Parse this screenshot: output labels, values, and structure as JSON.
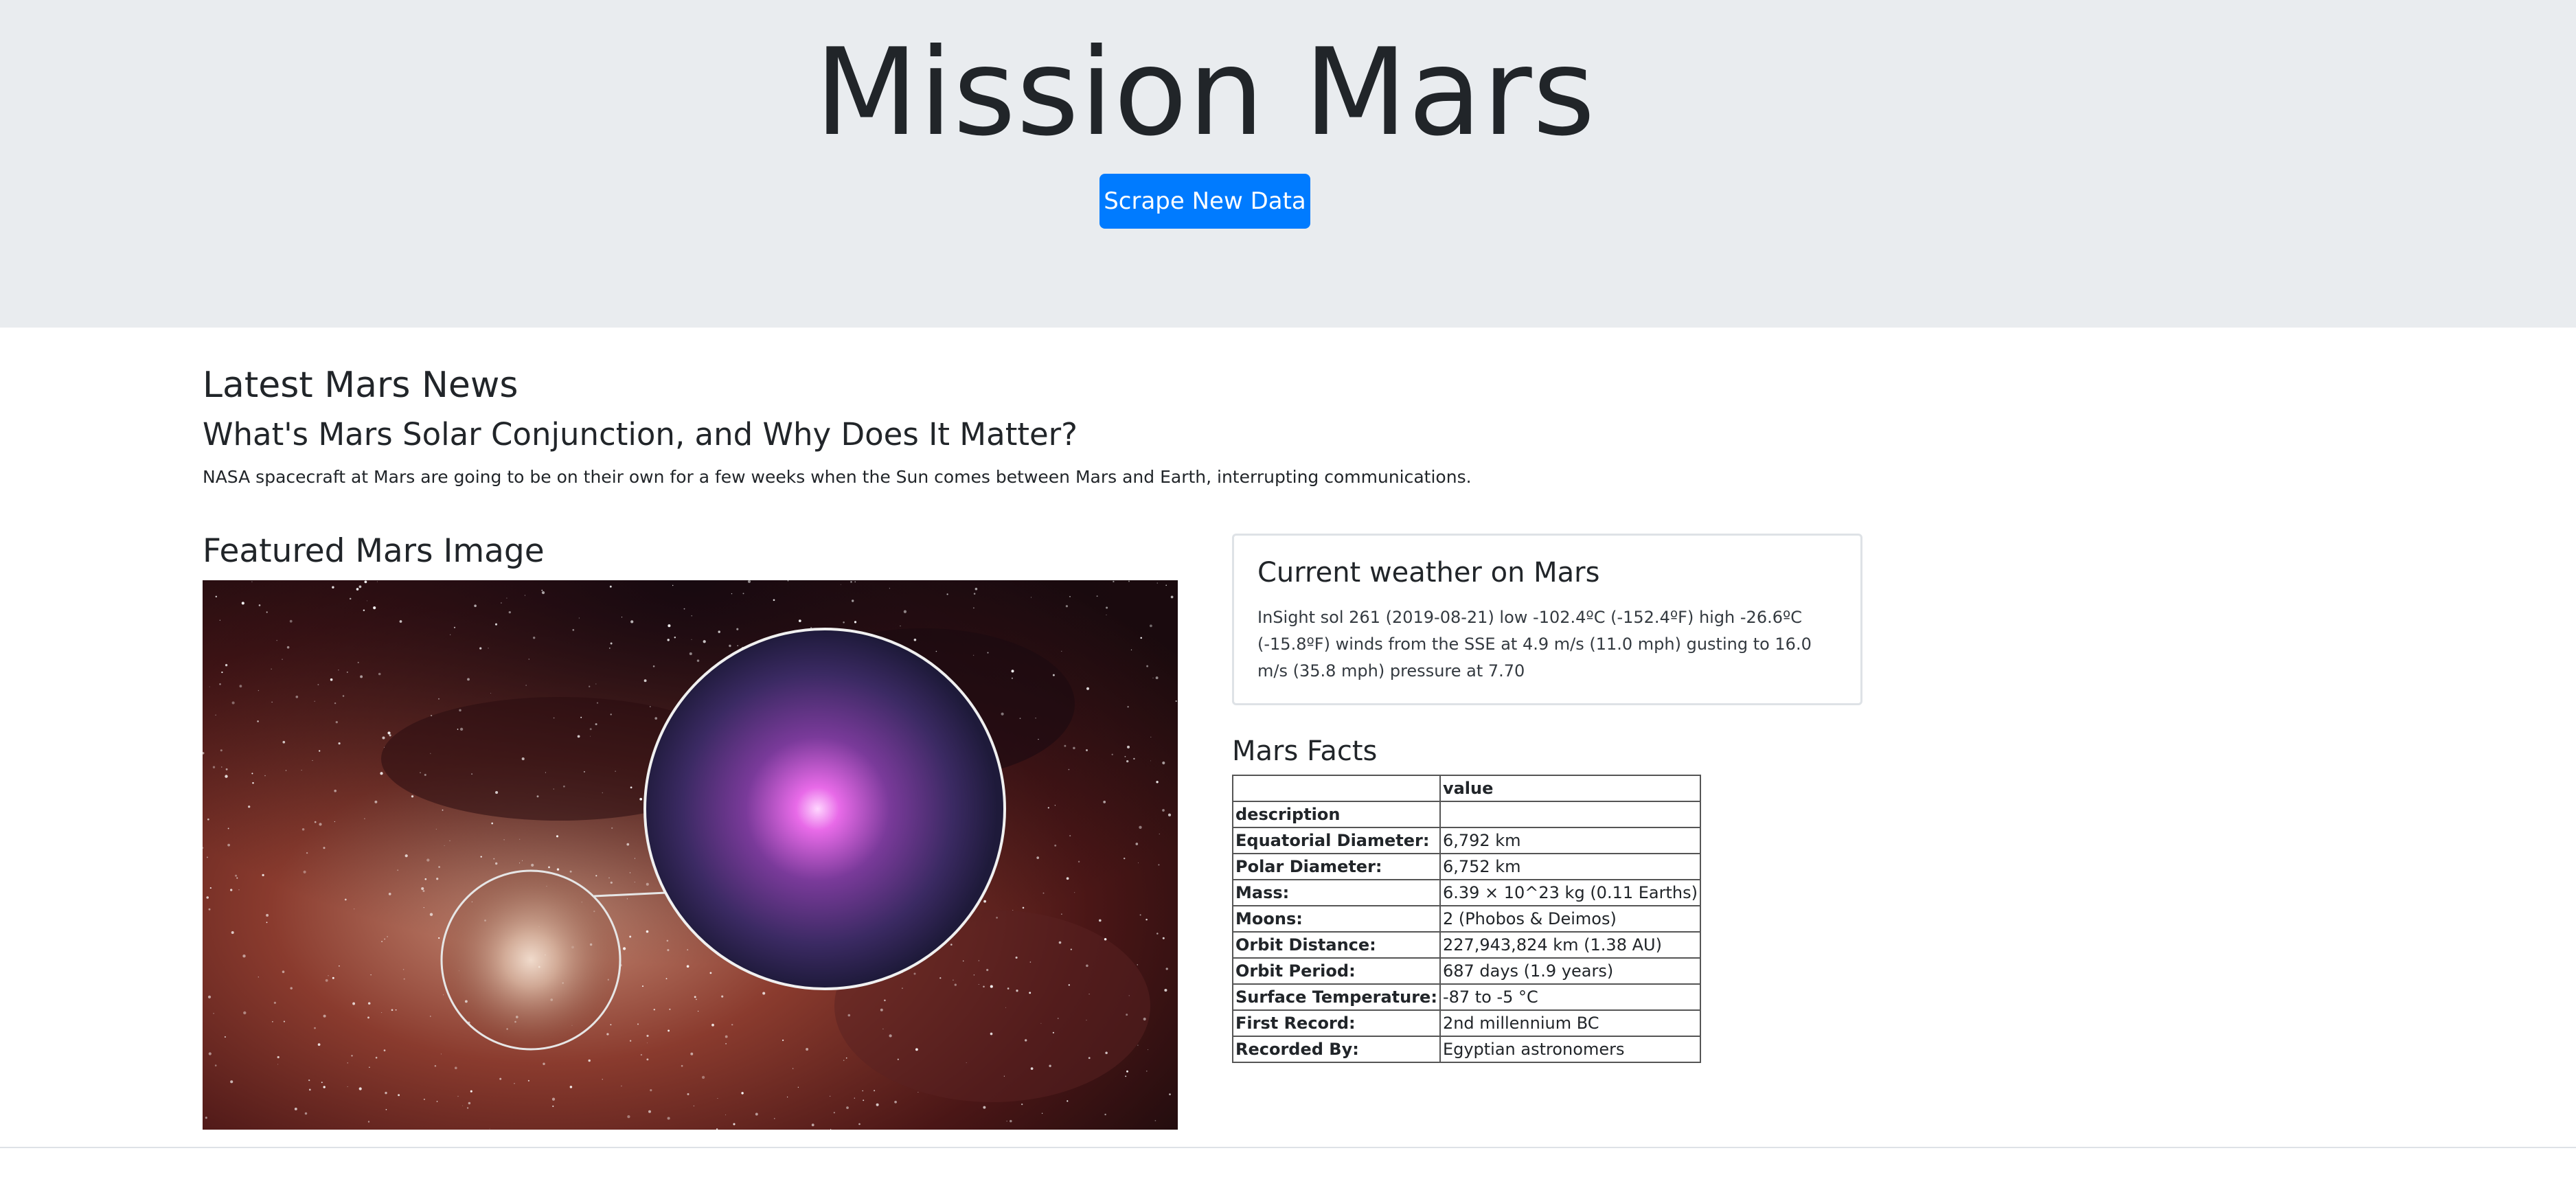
{
  "header": {
    "title": "Mission Mars",
    "scrape_button_label": "Scrape New Data",
    "background_color": "#e9ecef",
    "button_color": "#007bff"
  },
  "news": {
    "section_heading": "Latest Mars News",
    "title": "What's Mars Solar Conjunction, and Why Does It Matter?",
    "teaser": "NASA spacecraft at Mars are going to be on their own for a few weeks when the Sun comes between Mars and Earth, interrupting communications."
  },
  "featured_image": {
    "section_heading": "Featured Mars Image"
  },
  "weather": {
    "title": "Current weather on Mars",
    "text": "InSight sol 261 (2019-08-21) low -102.4ºC (-152.4ºF) high -26.6ºC (-15.8ºF) winds from the SSE at 4.9 m/s (11.0 mph) gusting to 16.0 m/s (35.8 mph) pressure at 7.70"
  },
  "facts": {
    "heading": "Mars Facts",
    "value_header": "value",
    "index_header": "description",
    "rows": [
      {
        "label": "Equatorial Diameter:",
        "value": "6,792 km"
      },
      {
        "label": "Polar Diameter:",
        "value": "6,752 km"
      },
      {
        "label": "Mass:",
        "value": "6.39 × 10^23 kg (0.11 Earths)"
      },
      {
        "label": "Moons:",
        "value": "2 (Phobos & Deimos)"
      },
      {
        "label": "Orbit Distance:",
        "value": "227,943,824 km (1.38 AU)"
      },
      {
        "label": "Orbit Period:",
        "value": "687 days (1.9 years)"
      },
      {
        "label": "Surface Temperature:",
        "value": "-87 to -5 °C"
      },
      {
        "label": "First Record:",
        "value": "2nd millennium BC"
      },
      {
        "label": "Recorded By:",
        "value": "Egyptian astronomers"
      }
    ]
  }
}
